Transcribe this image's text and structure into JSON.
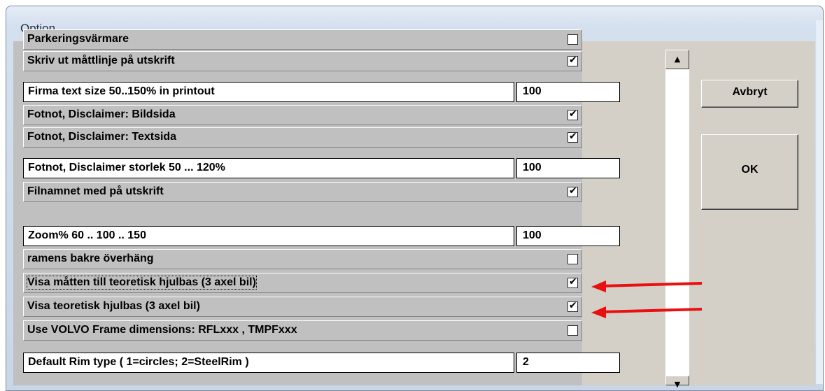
{
  "window": {
    "title": "Option"
  },
  "rows": {
    "r0": {
      "label": "Parkeringsvärmare"
    },
    "r1": {
      "label": "Skriv ut måttlinje på utskrift",
      "checked": true
    },
    "r2": {
      "label": "Firma text size  50..150% in printout",
      "value": "100"
    },
    "r3": {
      "label": "Fotnot, Disclaimer: Bildsida",
      "checked": true
    },
    "r4": {
      "label": "Fotnot, Disclaimer: Textsida",
      "checked": true
    },
    "r5": {
      "label": "Fotnot, Disclaimer storlek  50 ... 120%",
      "value": "100"
    },
    "r6": {
      "label": "Filnamnet med på utskrift",
      "checked": true
    },
    "r7": {
      "label": "Zoom% 60 .. 100 .. 150",
      "value": "100"
    },
    "r8": {
      "label": "ramens bakre överhäng",
      "checked": false
    },
    "r9": {
      "label": "Visa måtten till teoretisk hjulbas  (3 axel bil)",
      "checked": true
    },
    "r10": {
      "label": "Visa teoretisk hjulbas  (3 axel bil)",
      "checked": true
    },
    "r11": {
      "label": "Use VOLVO Frame dimensions: RFLxxx , TMPFxxx",
      "checked": false
    },
    "r12": {
      "label": "Default Rim type ( 1=circles; 2=SteelRim )",
      "value": "2"
    }
  },
  "check_glyph": "✔",
  "buttons": {
    "cancel": "Avbryt",
    "ok": "OK"
  },
  "scrollbar": {
    "up": "▲",
    "down": "▼"
  },
  "annotation": {
    "arrow_color": "#e81010"
  }
}
